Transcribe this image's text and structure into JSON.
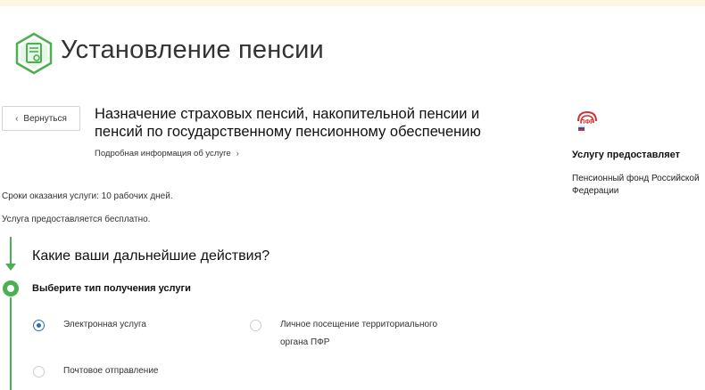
{
  "header": {
    "title": "Установление пенсии",
    "logo_icon": "pension-document-icon",
    "accent_color": "#4caf50"
  },
  "nav": {
    "back_label": "Вернуться",
    "back_icon": "chevron-left-icon"
  },
  "service": {
    "title": "Назначение страховых пенсий, накопительной пенсии и пенсий по государственному пенсионному обеспечению",
    "more_info_label": "Подробная информация об услуге"
  },
  "provider": {
    "heading": "Услугу предоставляет",
    "name": "Пенсионный фонд Российской Федерации",
    "logo_icon": "pfr-logo-icon"
  },
  "info": {
    "deadline": "Сроки оказания услуги: 10 рабочих дней.",
    "cost": "Услуга предоставляется бесплатно."
  },
  "step": {
    "question": "Какие ваши дальнейшие действия?",
    "label": "Выберите тип получения услуги",
    "options": [
      {
        "label": "Электронная услуга",
        "selected": true
      },
      {
        "label": "Личное посещение территориального органа ПФР",
        "selected": false
      },
      {
        "label": "Почтовое отправление",
        "selected": false
      }
    ]
  }
}
